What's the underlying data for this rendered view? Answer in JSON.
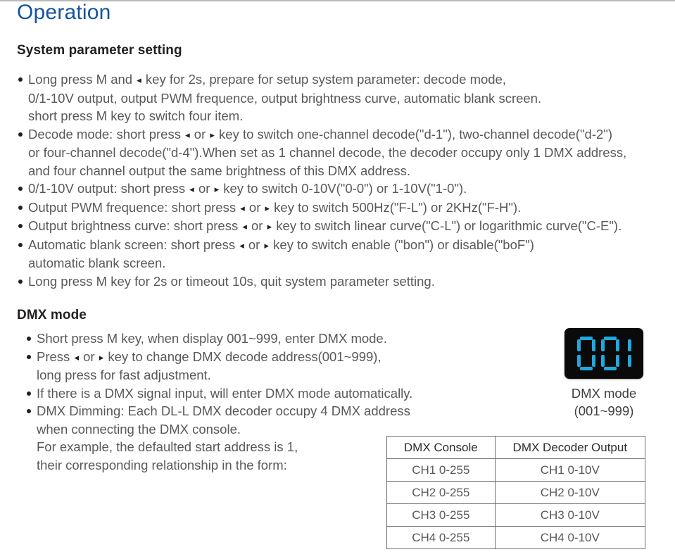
{
  "document": {
    "title": "Operation",
    "title_color": "#15539e"
  },
  "sections": {
    "system": {
      "heading": "System parameter setting",
      "bullets": [
        {
          "lines": [
            "Long press M and ◂ key for 2s, prepare for setup system parameter: decode mode,",
            "0/1-10V output, output PWM frequence, output brightness curve, automatic blank screen.",
            "short press M key to switch four item."
          ]
        },
        {
          "lines": [
            "Decode mode: short press ◂ or ▸ key to switch one-channel decode(\"d-1\"), two-channel decode(\"d-2\")",
            "or four-channel decode(\"d-4\").When set as 1 channel decode, the decoder occupy only 1 DMX address,",
            "and four channel output the same brightness of this DMX address."
          ]
        },
        {
          "lines": [
            "0/1-10V output: short press ◂ or ▸ key to switch 0-10V(\"0-0\") or 1-10V(\"1-0\")."
          ]
        },
        {
          "lines": [
            "Output PWM frequence: short press ◂ or ▸ key to switch 500Hz(\"F-L\") or 2KHz(\"F-H\")."
          ]
        },
        {
          "lines": [
            "Output brightness curve: short press ◂ or ▸ key to switch linear curve(\"C-L\") or logarithmic curve(\"C-E\")."
          ]
        },
        {
          "lines": [
            "Automatic blank screen: short press ◂ or ▸ key to switch enable (\"bon\") or disable(\"boF\")",
            "automatic blank screen."
          ]
        },
        {
          "lines": [
            "Long press M key for 2s or timeout 10s, quit system parameter setting."
          ]
        }
      ]
    },
    "dmx": {
      "heading": "DMX mode",
      "bullets": [
        {
          "lines": [
            "Short press M key, when display 001~999, enter DMX mode."
          ]
        },
        {
          "lines": [
            "Press  ◂ or ▸ key to change DMX decode address(001~999),",
            "long press for fast adjustment."
          ]
        },
        {
          "lines": [
            "If there is a DMX signal input, will enter DMX mode automatically."
          ]
        },
        {
          "lines": [
            "DMX Dimming: Each DL-L DMX decoder occupy 4 DMX address",
            "when connecting the DMX console.",
            "For example, the defaulted start address is 1,",
            "their corresponding relationship in the form:"
          ]
        }
      ]
    }
  },
  "display": {
    "value": "001",
    "digits": [
      "0",
      "0",
      "1"
    ],
    "segment_color": "#1fa9e0",
    "background_color": "#0a0a0a",
    "caption_line1": "DMX mode",
    "caption_line2": "(001~999)"
  },
  "table": {
    "headers": [
      "DMX Console",
      "DMX Decoder Output"
    ],
    "rows": [
      [
        "CH1 0-255",
        "CH1 0-10V"
      ],
      [
        "CH2 0-255",
        "CH2 0-10V"
      ],
      [
        "CH3 0-255",
        "CH3 0-10V"
      ],
      [
        "CH4 0-255",
        "CH4 0-10V"
      ]
    ]
  }
}
